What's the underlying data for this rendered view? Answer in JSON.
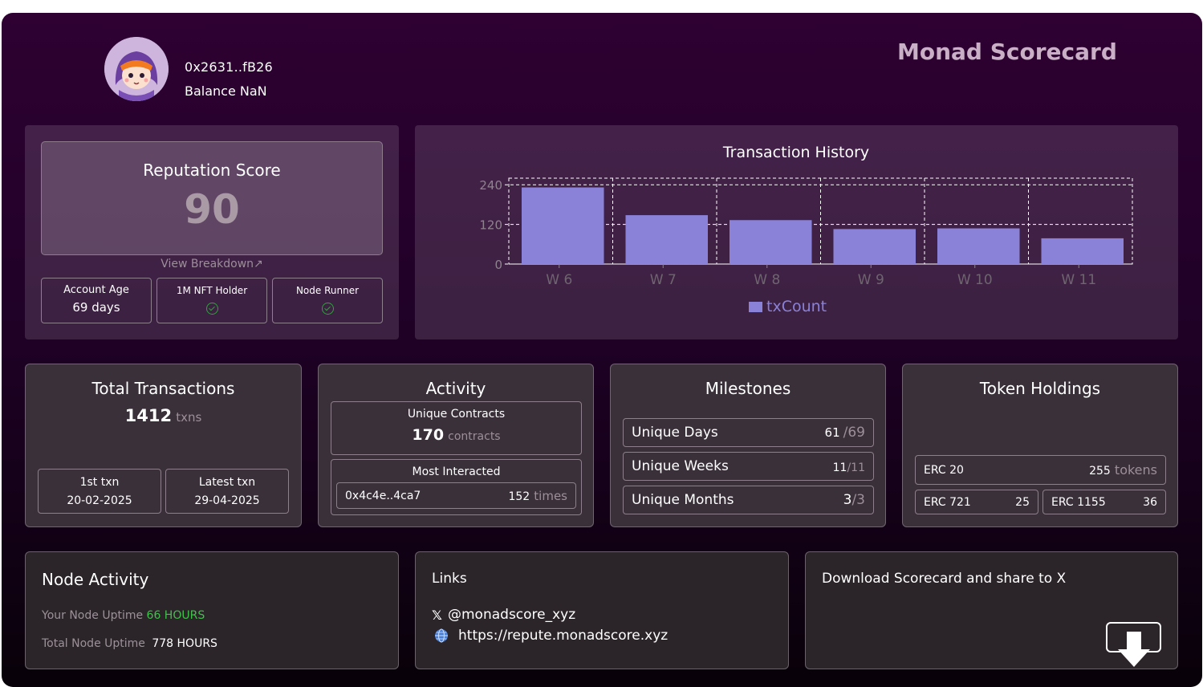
{
  "header": {
    "address": "0x2631..fB26",
    "balance": "Balance NaN",
    "brand": "Monad Scorecard"
  },
  "reputation": {
    "title": "Reputation Score",
    "score": "90",
    "breakdown_link": "View Breakdown↗",
    "stats": [
      {
        "label": "Account Age",
        "value": "69 days"
      },
      {
        "label": "1M NFT Holder",
        "icon": "check-circle-icon"
      },
      {
        "label": "Node Runner",
        "icon": "check-circle-icon"
      }
    ]
  },
  "chart_data": {
    "type": "bar",
    "title": "Transaction History",
    "categories": [
      "W 6",
      "W 7",
      "W 8",
      "W 9",
      "W 10",
      "W 11"
    ],
    "series": [
      {
        "name": "txCount",
        "values": [
          232,
          148,
          133,
          106,
          108,
          78
        ]
      }
    ],
    "ylim": [
      0,
      260
    ],
    "yticks": [
      "240",
      "120",
      "0"
    ],
    "grid": true,
    "legend": "bottom",
    "color": "#8a82d8"
  },
  "total_tx": {
    "title": "Total Transactions",
    "count": "1412",
    "unit": "txns",
    "first_label": "1st txn",
    "first_date": "20-02-2025",
    "latest_label": "Latest txn",
    "latest_date": "29-04-2025"
  },
  "activity": {
    "title": "Activity",
    "contracts_label": "Unique Contracts",
    "contracts_count": "170",
    "contracts_unit": "contracts",
    "most_label": "Most Interacted",
    "most_addr": "0x4c4e..4ca7",
    "most_count": "152",
    "most_unit": "times"
  },
  "milestones": {
    "title": "Milestones",
    "items": [
      {
        "label": "Unique Days",
        "value": "61",
        "total": "/69"
      },
      {
        "label": "Unique Weeks",
        "value": "11",
        "total": "/11"
      },
      {
        "label": "Unique Months",
        "value": "3",
        "total": "/3"
      }
    ]
  },
  "tokens": {
    "title": "Token Holdings",
    "erc20_label": "ERC 20",
    "erc20_value": "255",
    "erc20_unit": "tokens",
    "erc721_label": "ERC 721",
    "erc721_value": "25",
    "erc1155_label": "ERC 1155",
    "erc1155_value": "36"
  },
  "node": {
    "title": "Node Activity",
    "your_label": "Your Node Uptime",
    "your_value": "66 HOURS",
    "total_label": "Total Node Uptime",
    "total_value": "778 HOURS"
  },
  "links": {
    "title": "Links",
    "x_handle": "@monadscore_xyz",
    "website": "https://repute.monadscore.xyz",
    "x_icon": "x-logo-icon",
    "web_icon": "globe-icon"
  },
  "download": {
    "text": "Download Scorecard and share to X",
    "icon": "download-arrow-icon"
  }
}
